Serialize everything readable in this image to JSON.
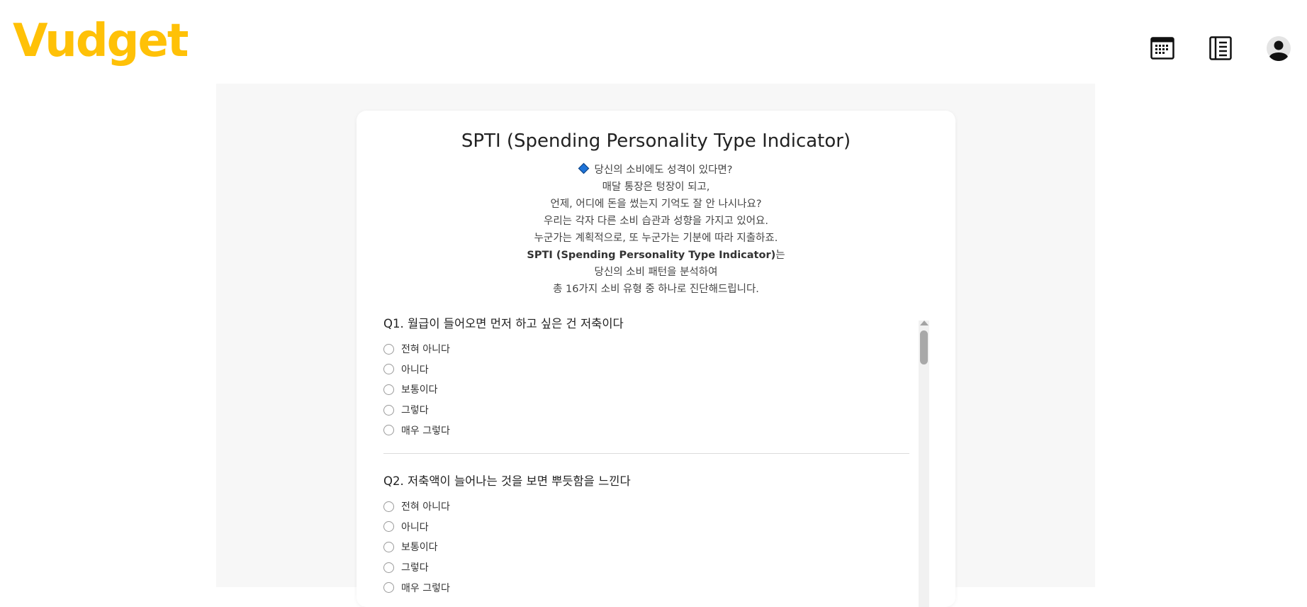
{
  "app": {
    "logo_text": "Vudget",
    "brand_color": "#FFC107"
  },
  "header": {
    "icons": [
      "calendar-icon",
      "ledger-icon",
      "profile-icon"
    ]
  },
  "survey": {
    "title": "SPTI (Spending Personality Type Indicator)",
    "intro_lines": [
      "당신의 소비에도 성격이 있다면?",
      "매달 통장은 텅장이 되고,",
      "언제, 어디에 돈을 썼는지 기억도 잘 안 나시나요?",
      "우리는 각자 다른 소비 습관과 성향을 가지고 있어요.",
      "누군가는 계획적으로, 또 누군가는 기분에 따라 지출하죠."
    ],
    "intro_bold": "SPTI (Spending Personality Type Indicator)",
    "intro_bold_suffix": "는",
    "intro_tail": [
      "당신의 소비 패턴을 분석하여",
      "총 16가지 소비 유형 중 하나로 진단해드립니다."
    ],
    "questions": [
      {
        "label": "Q1. 월급이 들어오면 먼저 하고 싶은 건 저축이다",
        "options": [
          "전혀 아니다",
          "아니다",
          "보통이다",
          "그렇다",
          "매우 그렇다"
        ]
      },
      {
        "label": "Q2. 저축액이 늘어나는 것을 보면 뿌듯함을 느낀다",
        "options": [
          "전혀 아니다",
          "아니다",
          "보통이다",
          "그렇다",
          "매우 그렇다"
        ]
      }
    ]
  }
}
